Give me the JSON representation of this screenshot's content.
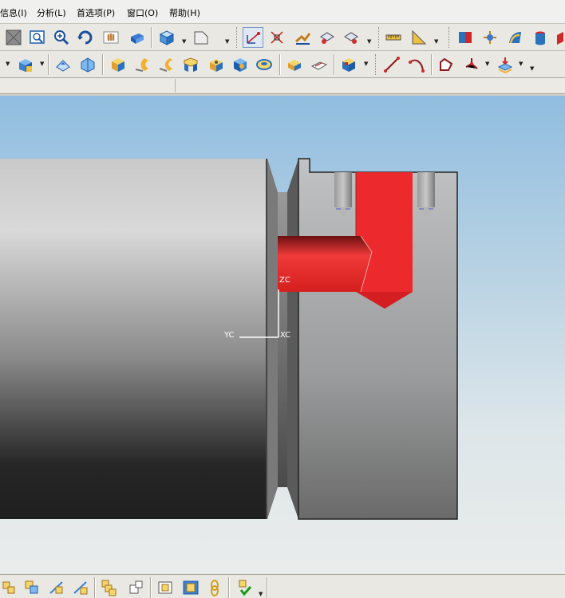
{
  "menubar": {
    "items": [
      {
        "label": "信息(I)"
      },
      {
        "label": "分析(L)"
      },
      {
        "label": "首选项(P)"
      },
      {
        "label": "窗口(O)"
      },
      {
        "label": "帮助(H)"
      }
    ]
  },
  "toolbar_top": {
    "icons": [
      "wireframe-icon",
      "zoom-window-icon",
      "zoom-icon",
      "rotate-icon",
      "pan-icon",
      "fit-icon",
      "shaded-cube-icon",
      "sketch-plane-icon",
      "point-constructor-icon",
      "point-set-icon",
      "transform-icon",
      "display-icon",
      "hide-icon",
      "measure-distance-icon",
      "measure-angle-icon",
      "analysis-icon",
      "coordinate-icon",
      "curve-icon",
      "surface-icon",
      "section-icon"
    ]
  },
  "toolbar_bottom": {
    "icons": [
      "extrude-icon",
      "boss-icon",
      "pad-icon",
      "block-icon",
      "cylinder-icon",
      "cone-icon",
      "sphere-icon",
      "hole-icon",
      "blend-icon",
      "chamfer-icon",
      "shell-icon",
      "draft-icon",
      "trim-icon",
      "line-icon",
      "arc-icon",
      "spline-icon",
      "point-icon",
      "offset-icon"
    ]
  },
  "viewport": {
    "triad": {
      "zc": "ZC",
      "yc": "YC",
      "xc": "XC"
    },
    "colors": {
      "tool": "#e8262a",
      "workpiece_dark": "#1f1f1f",
      "workpiece_light": "#d8d8d8"
    }
  },
  "bottombar": {
    "icons": [
      "assembly-icon",
      "component-icon",
      "constraint-icon",
      "reposition-icon",
      "explode-icon",
      "sequence-icon",
      "clone-icon",
      "wave-icon",
      "link-icon",
      "check-icon"
    ]
  }
}
